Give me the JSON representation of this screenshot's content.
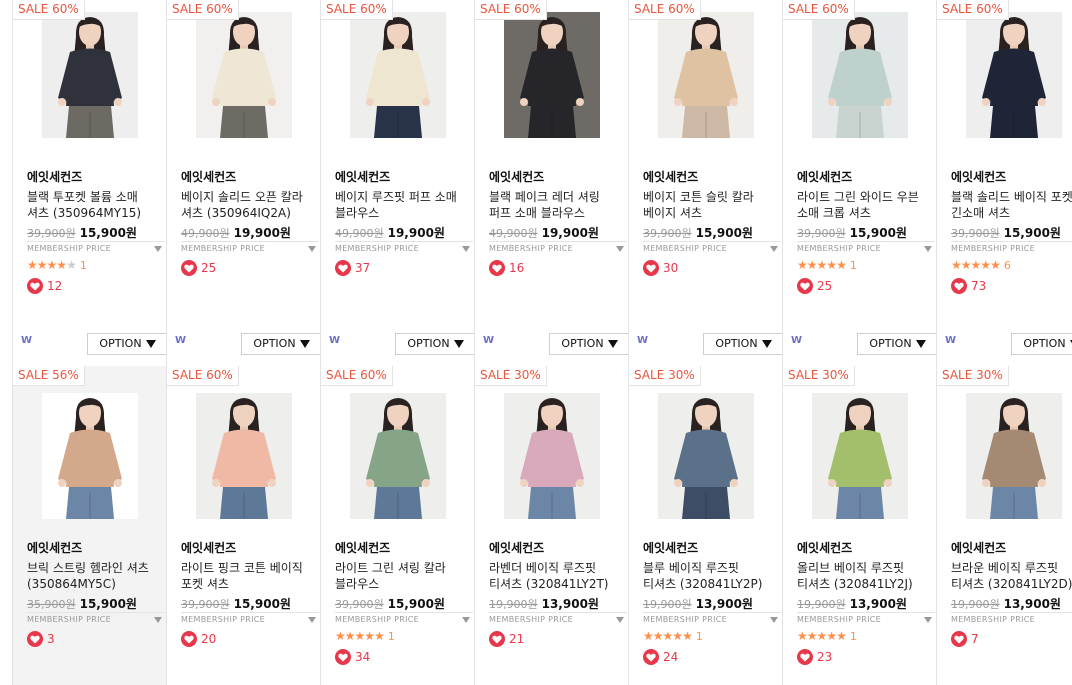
{
  "membership_label": "MEMBERSHIP PRICE",
  "option_label": "OPTION",
  "brand_mark": "W",
  "colors": {
    "sale": "#e8563d",
    "heart": "#e8374a",
    "star": "#ff8f4a",
    "border": "#e3e3e3"
  },
  "rows": [
    {
      "products": [
        {
          "sale": "SALE 60%",
          "brand": "에잇세컨즈",
          "name": "블랙 투포켓 볼륨 소매 셔츠 (350964MY15)",
          "old_price": "39,900원",
          "price": "15,900원",
          "rating": 4,
          "review_count": "1",
          "likes": "12",
          "shirt": "#2f323a",
          "pants": "#6d6a63",
          "bg": "#eeeeee"
        },
        {
          "sale": "SALE 60%",
          "brand": "에잇세컨즈",
          "name": "베이지 솔리드 오픈 칼라 셔츠 (350964IQ2A)",
          "old_price": "49,900원",
          "price": "19,900원",
          "rating": 0,
          "review_count": "",
          "likes": "25",
          "shirt": "#efe7d6",
          "pants": "#6e6b64",
          "bg": "#f1f0ee"
        },
        {
          "sale": "SALE 60%",
          "brand": "에잇세컨즈",
          "name": "베이지 루즈핏 퍼프 소매 블라우스",
          "old_price": "49,900원",
          "price": "19,900원",
          "rating": 0,
          "review_count": "",
          "likes": "37",
          "shirt": "#efe6d2",
          "pants": "#283349",
          "bg": "#eeeeec"
        },
        {
          "sale": "SALE 60%",
          "brand": "에잇세컨즈",
          "name": "블랙 페이크 레더 셔링 퍼프 소매 블라우스",
          "old_price": "49,900원",
          "price": "19,900원",
          "rating": 0,
          "review_count": "",
          "likes": "16",
          "shirt": "#26262a",
          "pants": "#26262a",
          "bg": "#6e6a66"
        },
        {
          "sale": "SALE 60%",
          "brand": "에잇세컨즈",
          "name": "베이지 코튼 슬릿 칼라 베이지 셔츠",
          "old_price": "39,900원",
          "price": "15,900원",
          "rating": 0,
          "review_count": "",
          "likes": "30",
          "shirt": "#dfc2a2",
          "pants": "#cdb9a6",
          "bg": "#efeeeb"
        },
        {
          "sale": "SALE 60%",
          "brand": "에잇세컨즈",
          "name": "라이트 그린 와이드 우븐 소매 크롭 셔츠",
          "old_price": "39,900원",
          "price": "15,900원",
          "rating": 5,
          "review_count": "1",
          "likes": "25",
          "shirt": "#bfd1cd",
          "pants": "#c9d4d0",
          "bg": "#e7eaea"
        },
        {
          "sale": "SALE 60%",
          "brand": "에잇세컨즈",
          "name": "블랙 솔리드 베이직 포켓 긴소매 셔츠",
          "old_price": "39,900원",
          "price": "15,900원",
          "rating": 5,
          "review_count": "6",
          "likes": "73",
          "shirt": "#1f2536",
          "pants": "#1f2536",
          "bg": "#eeeeee"
        }
      ]
    },
    {
      "products": [
        {
          "sale": "SALE 56%",
          "brand": "에잇세컨즈",
          "name": "브릭 스트링 헴라인 셔츠 (350864MY5C)",
          "old_price": "35,900원",
          "price": "15,900원",
          "rating": 0,
          "review_count": "",
          "likes": "3",
          "shirt": "#d4a98b",
          "pants": "#6c86a8",
          "bg": "#ffffff"
        },
        {
          "sale": "SALE 60%",
          "brand": "에잇세컨즈",
          "name": "라이트 핑크 코튼 베이직 포켓 셔츠",
          "old_price": "39,900원",
          "price": "15,900원",
          "rating": 0,
          "review_count": "",
          "likes": "20",
          "shirt": "#efb9a6",
          "pants": "#5e7898",
          "bg": "#eeeeec"
        },
        {
          "sale": "SALE 60%",
          "brand": "에잇세컨즈",
          "name": "라이트 그린 셔링 칼라 블라우스",
          "old_price": "39,900원",
          "price": "15,900원",
          "rating": 5,
          "review_count": "1",
          "likes": "34",
          "shirt": "#86a488",
          "pants": "#5e7898",
          "bg": "#eeeeec"
        },
        {
          "sale": "SALE 30%",
          "brand": "에잇세컨즈",
          "name": "라벤더 베이직 루즈핏 티셔츠 (320841LY2T)",
          "old_price": "19,900원",
          "price": "13,900원",
          "rating": 0,
          "review_count": "",
          "likes": "21",
          "shirt": "#d8a9bb",
          "pants": "#6c86a8",
          "bg": "#eeeeec"
        },
        {
          "sale": "SALE 30%",
          "brand": "에잇세컨즈",
          "name": "블루 베이직 루즈핏 티셔츠 (320841LY2P)",
          "old_price": "19,900원",
          "price": "13,900원",
          "rating": 5,
          "review_count": "1",
          "likes": "24",
          "shirt": "#5a7189",
          "pants": "#3e4d66",
          "bg": "#eeeeec"
        },
        {
          "sale": "SALE 30%",
          "brand": "에잇세컨즈",
          "name": "올리브 베이직 루즈핏 티셔츠 (320841LY2J)",
          "old_price": "19,900원",
          "price": "13,900원",
          "rating": 5,
          "review_count": "1",
          "likes": "23",
          "shirt": "#a4bf6c",
          "pants": "#6c86a8",
          "bg": "#eeeeec"
        },
        {
          "sale": "SALE 30%",
          "brand": "에잇세컨즈",
          "name": "브라운 베이직 루즈핏 티셔츠 (320841LY2D)",
          "old_price": "19,900원",
          "price": "13,900원",
          "rating": 0,
          "review_count": "",
          "likes": "7",
          "shirt": "#a48a72",
          "pants": "#6c86a8",
          "bg": "#eeeeec"
        }
      ]
    }
  ]
}
